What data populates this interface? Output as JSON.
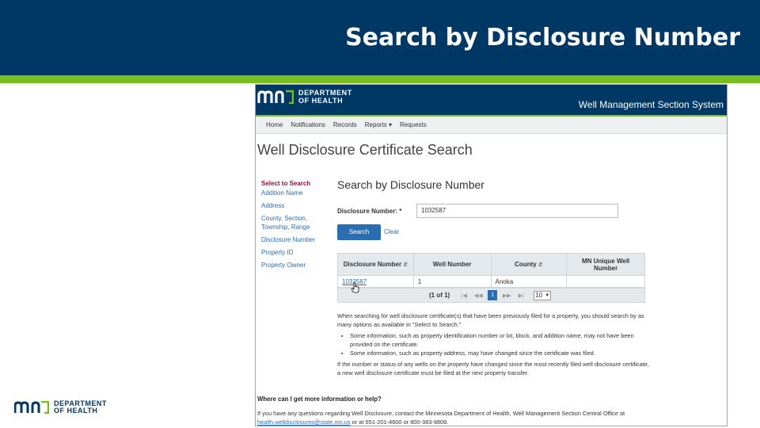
{
  "slide": {
    "title": "Search by Disclosure Number",
    "logo_line1": "DEPARTMENT",
    "logo_line2": "OF HEALTH"
  },
  "app": {
    "logo_line1": "DEPARTMENT",
    "logo_line2": "OF HEALTH",
    "system_name": "Well Management Section System",
    "nav": {
      "home": "Home",
      "notifications": "Notifications",
      "records": "Records",
      "reports": "Reports ▾",
      "requests": "Requests"
    },
    "page_heading": "Well Disclosure Certificate Search",
    "left_nav": {
      "title": "Select to Search",
      "items": [
        "Addition Name",
        "Address",
        "County, Section, Township, Range",
        "Disclosure Number",
        "Property ID",
        "Property Owner"
      ]
    },
    "form": {
      "heading": "Search by Disclosure Number",
      "label": "Disclosure Number: *",
      "value": "1032587",
      "search_label": "Search",
      "clear_label": "Clear"
    },
    "table": {
      "headers": [
        "Disclosure Number",
        "Well Number",
        "County",
        "MN Unique Well Number"
      ],
      "rows": [
        [
          "1032587",
          "1",
          "Anoka",
          ""
        ]
      ]
    },
    "pager": {
      "count": "(1 of 1)",
      "current_page": "1",
      "page_size": "10"
    },
    "info": {
      "intro": "When searching for well disclosure certificate(s) that have been previously filed for a property, you should search by as many options as available in \"Select to Search.\"",
      "bullet1": "Some information, such as property identification number or lot, block, and addition name, may not have been provided on the certificate.",
      "bullet2": "Some information, such as property address, may have changed since the certificate was filed.",
      "closing": "If the number or status of any wells on the property have changed since the most recently filed well disclosure certificate, a new well disclosure certificate must be filed at the next property transfer."
    },
    "help": {
      "heading": "Where can I get more information or help?",
      "text": "If you have any questions regarding Well Disclosure, contact the Minnesota Department of Health, Well Management Section Central Office at",
      "email": "health.welldisclosures@state.mn.us",
      "phones": "or at 651-201-4600 or 800-383-9808."
    }
  },
  "colors": {
    "navy": "#003865",
    "green": "#78be20",
    "link_blue": "#2a6db0"
  }
}
